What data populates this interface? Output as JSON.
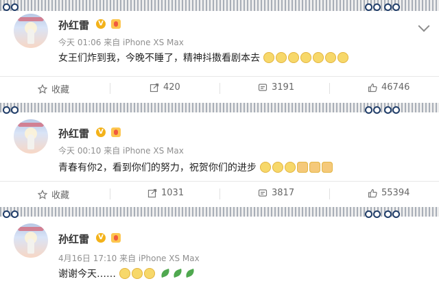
{
  "posts": [
    {
      "name": "孙红雷",
      "verified": "V",
      "meta": "今天 01:06 来自 iPhone XS Max",
      "text": "女王们炸到我，今晚不睡了，精神抖擞看剧本去",
      "actions": {
        "favorite": "收藏",
        "repost": "420",
        "comment": "3191",
        "like": "46746"
      }
    },
    {
      "name": "孙红雷",
      "verified": "V",
      "meta": "今天 00:10 来自 iPhone XS Max",
      "text": "青春有你2，看到你们的努力，祝贺你们的进步",
      "actions": {
        "favorite": "收藏",
        "repost": "1031",
        "comment": "3817",
        "like": "55394"
      }
    },
    {
      "name": "孙红雷",
      "verified": "V",
      "meta": "4月16日 17:10 来自 iPhone XS Max",
      "text": "谢谢今天……"
    }
  ],
  "colors": {
    "verified": "#f3b21a",
    "text": "#222222",
    "meta": "#8f8f8f"
  }
}
